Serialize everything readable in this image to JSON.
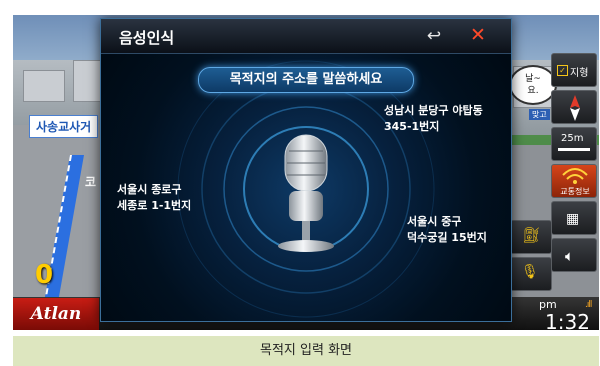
{
  "dialog": {
    "title": "음성인식",
    "back_icon": "back-arrow-icon",
    "close_icon": "close-icon",
    "prompt": "목적지의 주소를 말씀하세요",
    "examples": [
      [
        "성남시 분당구 야탑동",
        "345-1번지"
      ],
      [
        "서울시 종로구",
        "세종로 1-1번지"
      ],
      [
        "서울시 중구",
        "덕수궁길 15번지"
      ]
    ],
    "mic_icon": "microphone-icon"
  },
  "map": {
    "road_sign": "사송교사거",
    "speed": "0",
    "bubble_text": "날~\n요.",
    "stage_label": "맞고",
    "side_street": "코"
  },
  "right_panel": {
    "view_label": "지형",
    "scale_label": "25m",
    "traffic_label": "교통정보"
  },
  "status_bar": {
    "logo": "Atlan",
    "ampm": "pm",
    "time": "1:32",
    "signal": ".ıll"
  },
  "caption": "목적지 입력 화면",
  "colors": {
    "accent": "#3b8fd6",
    "close": "#ff4a2a",
    "logo_red": "#c81d14",
    "caption_bg": "#dde6bf"
  }
}
